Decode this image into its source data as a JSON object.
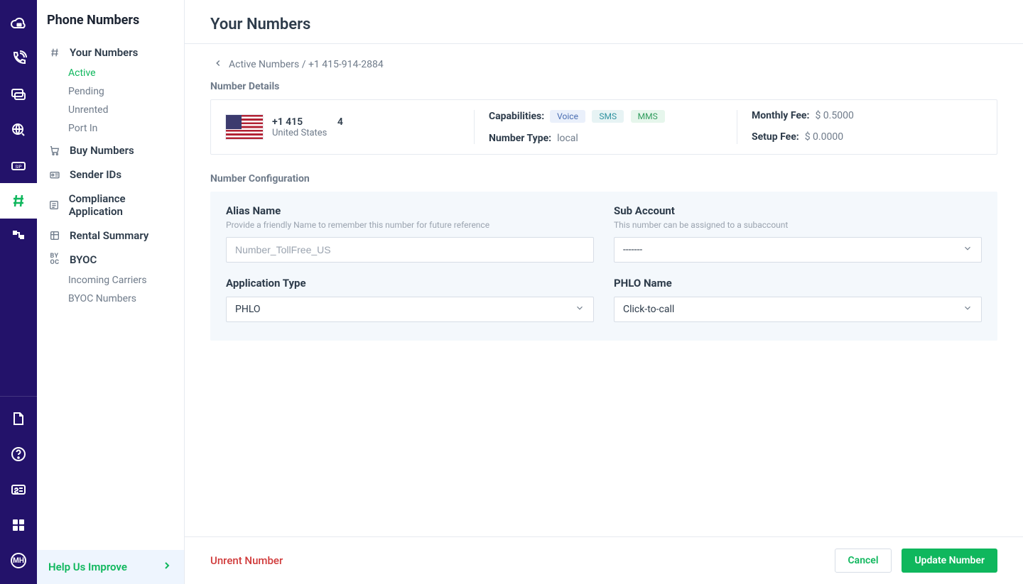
{
  "rail": {
    "items_top": [
      {
        "name": "logo-icon"
      },
      {
        "name": "phone-icon"
      },
      {
        "name": "messages-icon"
      },
      {
        "name": "search-icon"
      },
      {
        "name": "sip-icon"
      },
      {
        "name": "hash-icon",
        "active": true
      },
      {
        "name": "flow-icon"
      }
    ],
    "items_bottom": [
      {
        "name": "docs-icon"
      },
      {
        "name": "help-icon"
      },
      {
        "name": "billing-icon"
      },
      {
        "name": "apps-icon"
      },
      {
        "name": "account-icon",
        "badge": "MH"
      }
    ]
  },
  "sidebar": {
    "title": "Phone Numbers",
    "nav": [
      {
        "label": "Your Numbers",
        "icon": "hash-icon",
        "children": [
          {
            "label": "Active",
            "active": true
          },
          {
            "label": "Pending"
          },
          {
            "label": "Unrented"
          },
          {
            "label": "Port In"
          }
        ]
      },
      {
        "label": "Buy Numbers",
        "icon": "cart-icon"
      },
      {
        "label": "Sender IDs",
        "icon": "sender-id-icon"
      },
      {
        "label": "Compliance Application",
        "icon": "compliance-icon"
      },
      {
        "label": "Rental Summary",
        "icon": "summary-icon"
      },
      {
        "label": "BYOC",
        "icon": "byoc-icon",
        "children": [
          {
            "label": "Incoming Carriers"
          },
          {
            "label": "BYOC Numbers"
          }
        ]
      }
    ],
    "help": "Help Us Improve"
  },
  "page": {
    "title": "Your Numbers",
    "breadcrumb": "Active Numbers / +1 415-914-2884",
    "sections": {
      "details_title": "Number Details",
      "config_title": "Number Configuration"
    },
    "details": {
      "number_display": "+1 415              4",
      "country": "United States",
      "capabilities_label": "Capabilities:",
      "capabilities": {
        "voice": "Voice",
        "sms": "SMS",
        "mms": "MMS"
      },
      "number_type_label": "Number Type:",
      "number_type_value": "local",
      "monthly_fee_label": "Monthly Fee:",
      "monthly_fee_value": "$ 0.5000",
      "setup_fee_label": "Setup Fee:",
      "setup_fee_value": "$ 0.0000"
    },
    "config": {
      "alias": {
        "label": "Alias Name",
        "help": "Provide a friendly Name to remember this number for future reference",
        "placeholder": "Number_TollFree_US",
        "value": ""
      },
      "subaccount": {
        "label": "Sub Account",
        "help": "This number can be assigned to a subaccount",
        "value": "-------"
      },
      "app_type": {
        "label": "Application Type",
        "value": "PHLO"
      },
      "phlo_name": {
        "label": "PHLO Name",
        "value": "Click-to-call"
      }
    },
    "footer": {
      "unrent": "Unrent Number",
      "cancel": "Cancel",
      "update": "Update Number"
    }
  }
}
